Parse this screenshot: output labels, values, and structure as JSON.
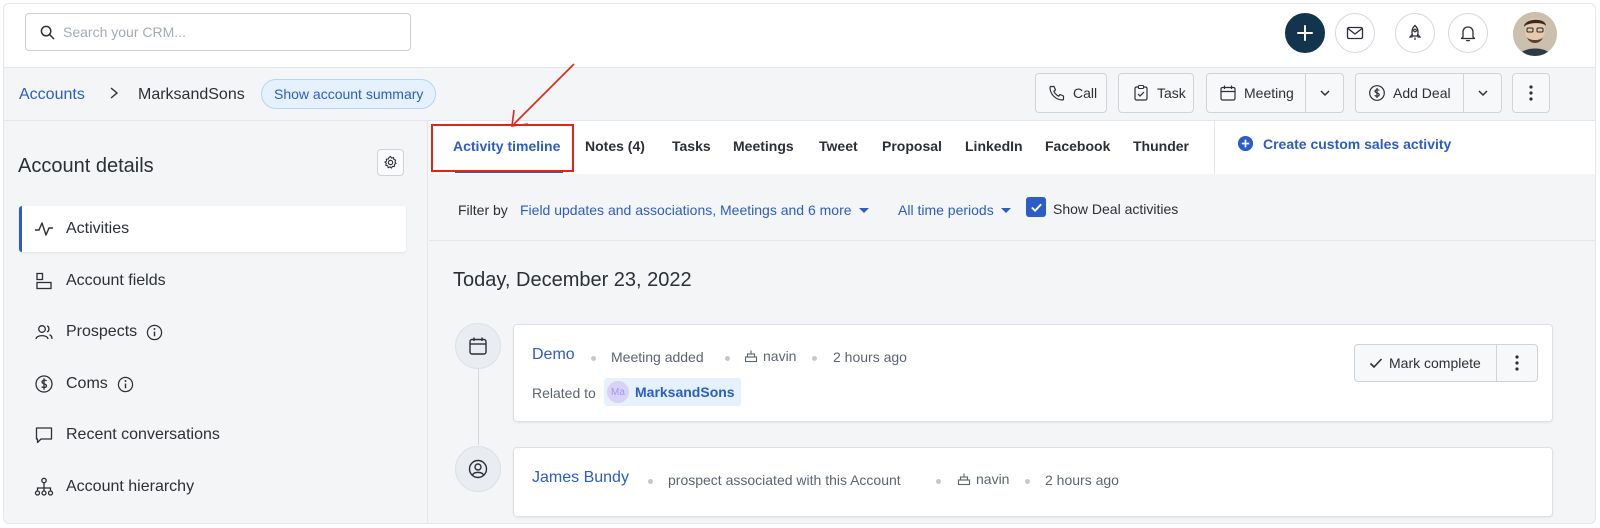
{
  "topbar": {
    "search_placeholder": "Search your CRM..."
  },
  "breadcrumb": {
    "root": "Accounts",
    "current": "MarksandSons",
    "summary_button": "Show account summary"
  },
  "actions": {
    "call": "Call",
    "task": "Task",
    "meeting": "Meeting",
    "add_deal": "Add Deal"
  },
  "left": {
    "title": "Account details",
    "items": [
      {
        "label": "Activities",
        "icon": "activity-icon"
      },
      {
        "label": "Account fields",
        "icon": "fields-icon"
      },
      {
        "label": "Prospects",
        "icon": "users-icon"
      },
      {
        "label": "Coms",
        "icon": "dollar-icon"
      },
      {
        "label": "Recent conversations",
        "icon": "chat-icon"
      },
      {
        "label": "Account hierarchy",
        "icon": "hierarchy-icon"
      }
    ]
  },
  "tabs": [
    "Activity timeline",
    "Notes (4)",
    "Tasks",
    "Meetings",
    "Tweet",
    "Proposal",
    "LinkedIn",
    "Facebook",
    "Thunder"
  ],
  "custom_activity": "Create custom sales activity",
  "filters": {
    "label": "Filter by",
    "types": "Field updates and associations, Meetings and 6 more",
    "period": "All time periods",
    "show_deals": "Show Deal activities"
  },
  "timeline": {
    "day": "Today, December 23, 2022",
    "entries": [
      {
        "title": "Demo",
        "action": "Meeting added",
        "user": "navin",
        "time": "2 hours ago",
        "related_label": "Related to",
        "related_initials": "Ma",
        "related_name": "MarksandSons",
        "button": "Mark complete"
      },
      {
        "title": "James Bundy",
        "action": "prospect associated with this Account",
        "user": "navin",
        "time": "2 hours ago"
      }
    ]
  },
  "colors": {
    "accent": "#2c5cc5",
    "annotation": "#e2231a",
    "primary_dark": "#12344d"
  }
}
